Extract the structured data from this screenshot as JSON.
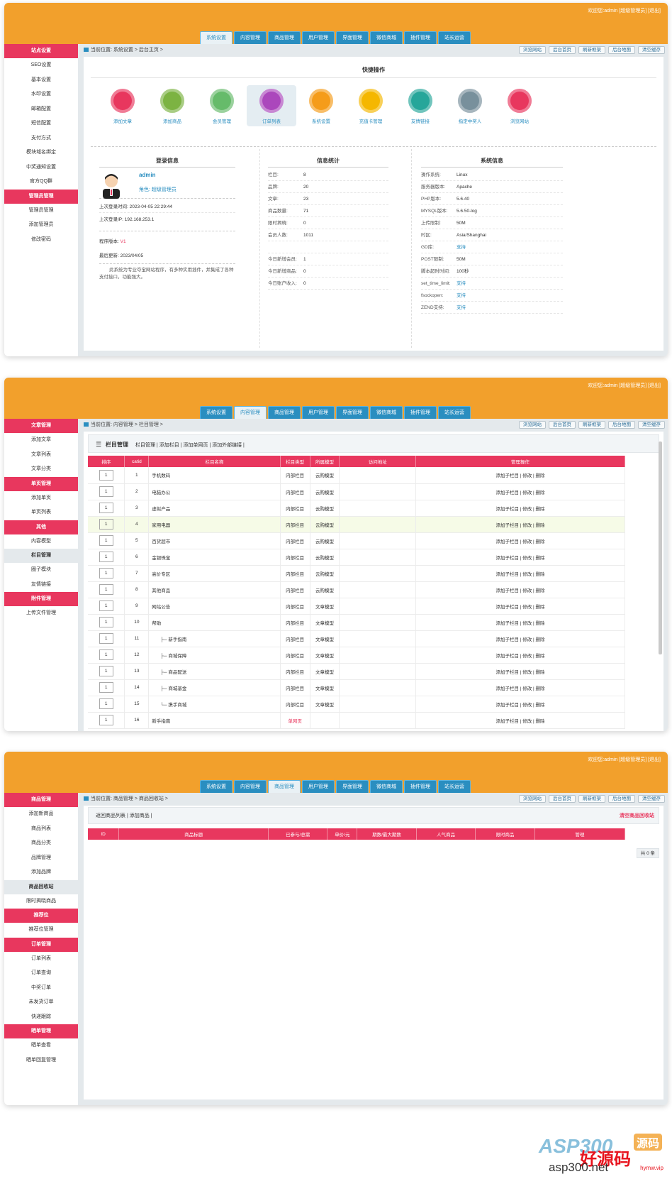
{
  "common": {
    "welcome": "欢迎您:admin [超级管理员] [退出]",
    "tabs": [
      "系统设置",
      "内容管理",
      "商品管理",
      "用户管理",
      "界面管理",
      "微信商城",
      "插件管理",
      "站长运营"
    ],
    "right_buttons": [
      "浏览网站",
      "后台首页",
      "刷新框架",
      "后台地图",
      "清空缓存"
    ]
  },
  "s1": {
    "sidebar": [
      {
        "t": "g",
        "label": "站点设置"
      },
      {
        "t": "i",
        "label": "SEO设置"
      },
      {
        "t": "i",
        "label": "基本设置"
      },
      {
        "t": "i",
        "label": "水印设置"
      },
      {
        "t": "i",
        "label": "邮箱配置"
      },
      {
        "t": "i",
        "label": "短信配置"
      },
      {
        "t": "i",
        "label": "支付方式"
      },
      {
        "t": "i",
        "label": "模块域名绑定"
      },
      {
        "t": "i",
        "label": "中奖通知设置"
      },
      {
        "t": "i",
        "label": "官方QQ群"
      },
      {
        "t": "g",
        "label": "管理员管理"
      },
      {
        "t": "i",
        "label": "管理员管理"
      },
      {
        "t": "i",
        "label": "添加管理员"
      },
      {
        "t": "i",
        "label": "修改密码"
      }
    ],
    "crumb": "当前位置: 系统设置 > 后台主页 >",
    "quick_title": "快捷操作",
    "quick": [
      {
        "label": "添加文章",
        "color": "#e8375e"
      },
      {
        "label": "添加商品",
        "color": "#7cb342"
      },
      {
        "label": "会员管理",
        "color": "#66bb6a"
      },
      {
        "label": "订单列表",
        "color": "#ab47bc"
      },
      {
        "label": "系统设置",
        "color": "#f59c1a"
      },
      {
        "label": "充值卡管理",
        "color": "#f5b700"
      },
      {
        "label": "友情链接",
        "color": "#26a69a"
      },
      {
        "label": "指定中奖人",
        "color": "#78909c"
      },
      {
        "label": "浏览网站",
        "color": "#e8375e"
      }
    ],
    "login": {
      "title": "登录信息",
      "user": "admin",
      "role": "角色: 超级管理员",
      "last_time": "上次登录时间: 2023-04-05 22:29:44",
      "last_ip": "上次登录IP: 192.168.253.1",
      "version_label": "程序版本:",
      "version": "V1",
      "update": "最后更新: 2023/04/05",
      "desc": "此系统为专业夺宝网站程序，有多种实用插件，并集成了各种支付接口，功能强大。"
    },
    "stats": {
      "title": "信息统计",
      "rows": [
        [
          "栏目:",
          "8"
        ],
        [
          "品牌:",
          "20"
        ],
        [
          "文章:",
          "23"
        ],
        [
          "商品数量:",
          "71"
        ],
        [
          "限时揭晓:",
          "0"
        ],
        [
          "会员人数:",
          "1011"
        ],
        [
          "",
          ""
        ],
        [
          "今日新增会员:",
          "1"
        ],
        [
          "今日新增商品:",
          "0"
        ],
        [
          "今日账户收入:",
          "0"
        ]
      ]
    },
    "sys": {
      "title": "系统信息",
      "rows": [
        [
          "操作系统:",
          "Linux"
        ],
        [
          "服务器版本:",
          "Apache"
        ],
        [
          "PHP版本:",
          "5.6.40"
        ],
        [
          "MYSQL版本:",
          "5.6.50-log"
        ],
        [
          "上传限制:",
          "50M"
        ],
        [
          "时区:",
          "Asia/Shanghai"
        ],
        [
          "GD库:",
          "支持"
        ],
        [
          "POST限制:",
          "50M"
        ],
        [
          "脚本超时时间:",
          "100秒"
        ],
        [
          "set_time_limit:",
          "支持"
        ],
        [
          "fsockopen:",
          "支持"
        ],
        [
          "ZEND支持:",
          "支持"
        ]
      ]
    }
  },
  "s2": {
    "sidebar": [
      {
        "t": "g",
        "label": "文章管理"
      },
      {
        "t": "i",
        "label": "添加文章"
      },
      {
        "t": "i",
        "label": "文章列表"
      },
      {
        "t": "i",
        "label": "文章分类"
      },
      {
        "t": "g",
        "label": "单页管理"
      },
      {
        "t": "i",
        "label": "添加单页"
      },
      {
        "t": "i",
        "label": "单页列表"
      },
      {
        "t": "g",
        "label": "其他"
      },
      {
        "t": "i",
        "label": "内容模型"
      },
      {
        "t": "s",
        "label": "栏目管理"
      },
      {
        "t": "i",
        "label": "圈子模块"
      },
      {
        "t": "i",
        "label": "友情链接"
      },
      {
        "t": "g",
        "label": "附件管理"
      },
      {
        "t": "i",
        "label": "上传文件管理"
      }
    ],
    "crumb": "当前位置: 内容管理 > 栏目管理 >",
    "bar_title": "栏目管理",
    "bar_links": "栏目管理 | 添加栏目 | 添加单网页 | 添加外部链接 |",
    "headers": [
      "排序",
      "catid",
      "栏目名称",
      "栏目类型",
      "所属模型",
      "访问地址",
      "管理操作"
    ],
    "rows": [
      [
        "1",
        "1",
        "手机数码",
        "内部栏目",
        "云购模型"
      ],
      [
        "1",
        "2",
        "电脑办公",
        "内部栏目",
        "云购模型"
      ],
      [
        "1",
        "3",
        "虚拟产品",
        "内部栏目",
        "云购模型"
      ],
      [
        "1",
        "4",
        "家用电器",
        "内部栏目",
        "云购模型"
      ],
      [
        "1",
        "5",
        "百货超市",
        "内部栏目",
        "云购模型"
      ],
      [
        "1",
        "6",
        "金银珠宝",
        "内部栏目",
        "云购模型"
      ],
      [
        "1",
        "7",
        "高价专区",
        "内部栏目",
        "云购模型"
      ],
      [
        "1",
        "8",
        "其他商品",
        "内部栏目",
        "云购模型"
      ],
      [
        "1",
        "9",
        "网站公告",
        "内部栏目",
        "文章模型"
      ],
      [
        "1",
        "10",
        "帮助",
        "内部栏目",
        "文章模型"
      ],
      [
        "1",
        "11",
        "├─ 新手指南",
        "内部栏目",
        "文章模型"
      ],
      [
        "1",
        "12",
        "├─ 商城保障",
        "内部栏目",
        "文章模型"
      ],
      [
        "1",
        "13",
        "├─ 商品配送",
        "内部栏目",
        "文章模型"
      ],
      [
        "1",
        "14",
        "├─ 商城基金",
        "内部栏目",
        "文章模型"
      ],
      [
        "1",
        "15",
        "└─ 携手商城",
        "内部栏目",
        "文章模型"
      ],
      [
        "1",
        "16",
        "新手指南",
        "单网页",
        ""
      ]
    ],
    "ops": "添加子栏目 | 修改 | 删除"
  },
  "s3": {
    "sidebar": [
      {
        "t": "g",
        "label": "商品管理"
      },
      {
        "t": "i",
        "label": "添加新商品"
      },
      {
        "t": "i",
        "label": "商品列表"
      },
      {
        "t": "i",
        "label": "商品分类"
      },
      {
        "t": "i",
        "label": "品牌管理"
      },
      {
        "t": "i",
        "label": "添加品牌"
      },
      {
        "t": "s",
        "label": "商品回收站"
      },
      {
        "t": "i",
        "label": "限时揭晓商品"
      },
      {
        "t": "g",
        "label": "推荐位"
      },
      {
        "t": "i",
        "label": "推荐位管理"
      },
      {
        "t": "g",
        "label": "订单管理"
      },
      {
        "t": "i",
        "label": "订单列表"
      },
      {
        "t": "i",
        "label": "订单查询"
      },
      {
        "t": "i",
        "label": "中奖订单"
      },
      {
        "t": "i",
        "label": "未发货订单"
      },
      {
        "t": "i",
        "label": "快递跟踪"
      },
      {
        "t": "g",
        "label": "晒单管理"
      },
      {
        "t": "i",
        "label": "晒单查看"
      },
      {
        "t": "i",
        "label": "晒单回复管理"
      }
    ],
    "crumb": "当前位置: 商品管理 > 商品回收站 >",
    "bar_links": "返回商品列表 | 添加商品 |",
    "clear": "清空商品回收站",
    "headers": [
      "ID",
      "商品标题",
      "已参与/总需",
      "单价/元",
      "期数/最大期数",
      "人气商品",
      "限时商品",
      "管理"
    ],
    "total": "共 0 条"
  },
  "watermark": {
    "logo": "ASP300",
    "cn": "好源码",
    "sub": "源码",
    "url": "asp300.net",
    "url2": "hymw.vip"
  }
}
